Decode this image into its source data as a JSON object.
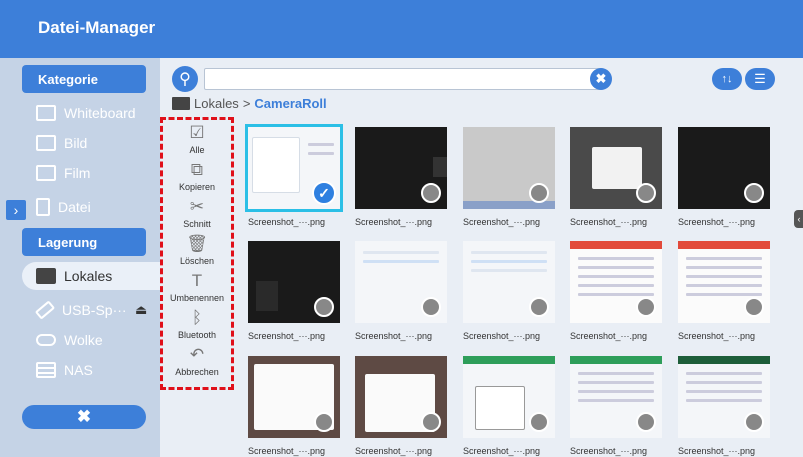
{
  "app": {
    "title": "Datei-Manager"
  },
  "colors": {
    "accent": "#3d7fd9",
    "selection": "#2bbfe6",
    "highlight_border": "#e0101a"
  },
  "sidebar": {
    "category_heading": "Kategorie",
    "category_items": [
      {
        "label": "Whiteboard",
        "icon": "whiteboard-icon"
      },
      {
        "label": "Bild",
        "icon": "image-icon"
      },
      {
        "label": "Film",
        "icon": "film-icon"
      },
      {
        "label": "Datei",
        "icon": "file-icon"
      }
    ],
    "storage_heading": "Lagerung",
    "storage_items": [
      {
        "label": "Lokales",
        "icon": "local-storage-icon",
        "active": true
      },
      {
        "label": "USB-Sp···",
        "icon": "usb-icon"
      },
      {
        "label": "Wolke",
        "icon": "cloud-icon"
      },
      {
        "label": "NAS",
        "icon": "nas-icon"
      }
    ],
    "close_label": "✖"
  },
  "toolbar": {
    "search_value": "",
    "search_placeholder": "",
    "clear_label": "✖",
    "sort_label": "↑↓",
    "view_label": "☰"
  },
  "breadcrumb": {
    "root": "Lokales",
    "separator": ">",
    "current": "CameraRoll"
  },
  "actions": [
    {
      "label": "Alle",
      "icon": "☑"
    },
    {
      "label": "Kopieren",
      "icon": "⧉"
    },
    {
      "label": "Schnitt",
      "icon": "✂"
    },
    {
      "label": "Löschen",
      "icon": "🗑"
    },
    {
      "label": "Umbenennen",
      "icon": "T"
    },
    {
      "label": "Bluetooth",
      "icon": "ᛒ"
    },
    {
      "label": "Abbrechen",
      "icon": "↶"
    }
  ],
  "files": [
    {
      "name": "Screenshot_···.png",
      "selected": true
    },
    {
      "name": "Screenshot_···.png"
    },
    {
      "name": "Screenshot_···.png"
    },
    {
      "name": "Screenshot_···.png"
    },
    {
      "name": "Screenshot_···.png"
    },
    {
      "name": "Screenshot_···.png"
    },
    {
      "name": "Screenshot_···.png"
    },
    {
      "name": "Screenshot_···.png"
    },
    {
      "name": "Screenshot_···.png"
    },
    {
      "name": "Screenshot_···.png"
    },
    {
      "name": "Screenshot_···.png"
    },
    {
      "name": "Screenshot_···.png"
    },
    {
      "name": "Screenshot_···.png"
    },
    {
      "name": "Screenshot_···.png"
    },
    {
      "name": "Screenshot_···.png"
    }
  ]
}
